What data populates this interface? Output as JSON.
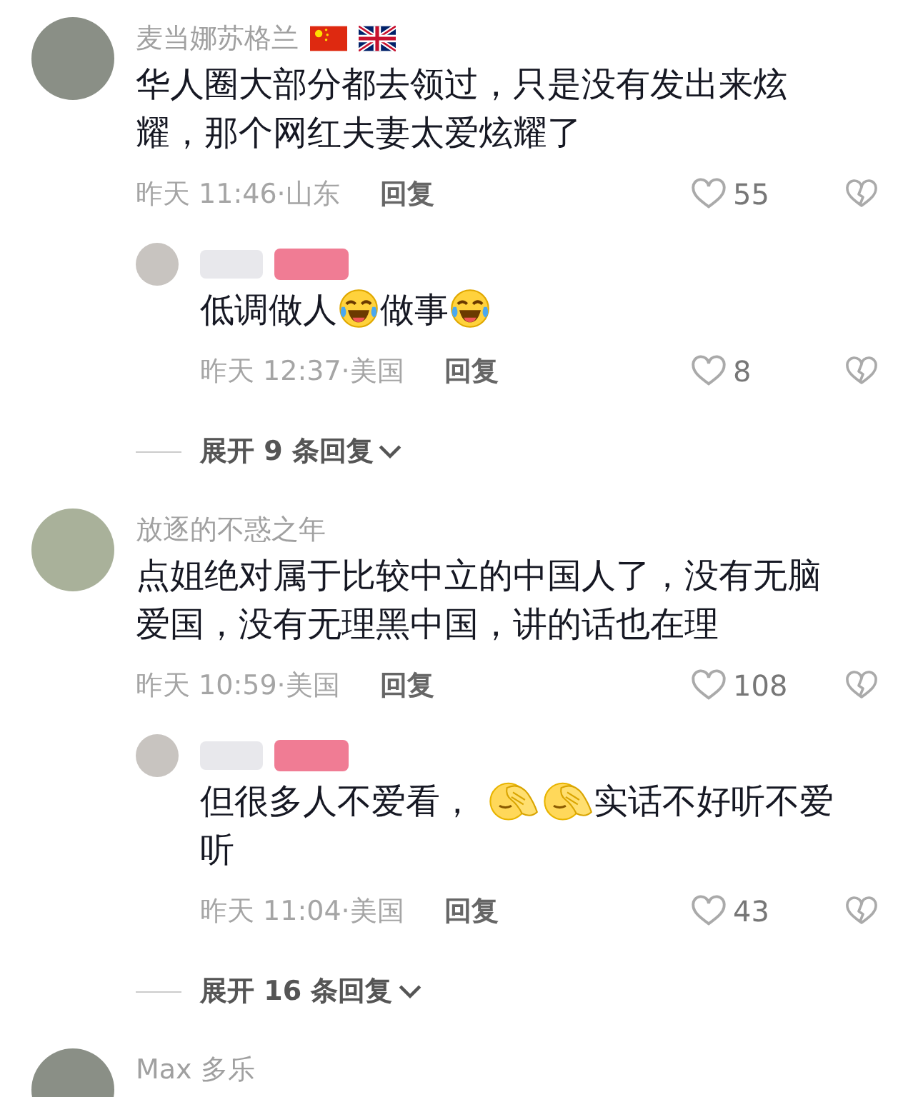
{
  "comments": [
    {
      "author": "麦当娜苏格兰",
      "flags": [
        {
          "kind": "cn"
        },
        {
          "kind": "uk"
        }
      ],
      "text": [
        {
          "kind": "text",
          "text": "华人圈大部分都去领过，只是没有发出来炫耀，那个网红夫妻太爱炫耀了"
        }
      ],
      "time": "昨天 11:46·山东",
      "reply_label": "回复",
      "likes": "55",
      "replies": [
        {
          "text": [
            {
              "kind": "text",
              "text": "低调做人"
            },
            {
              "kind": "laughing_tears"
            },
            {
              "kind": "text",
              "text": "做事"
            },
            {
              "kind": "laughing_tears"
            }
          ],
          "time": "昨天 12:37·美国",
          "reply_label": "回复",
          "likes": "8"
        }
      ],
      "expand_label": "展开 9 条回复"
    },
    {
      "author": "放逐的不惑之年",
      "text": [
        {
          "kind": "text",
          "text": "点姐绝对属于比较中立的中国人了，没有无脑爱国，没有无理黑中国，讲的话也在理"
        }
      ],
      "time": "昨天 10:59·美国",
      "reply_label": "回复",
      "likes": "108",
      "replies": [
        {
          "text": [
            {
              "kind": "text",
              "text": "但很多人不爱看， "
            },
            {
              "kind": "facepalm"
            },
            {
              "kind": "facepalm"
            },
            {
              "kind": "text",
              "text": "实话不好听不爱听"
            }
          ],
          "time": "昨天 11:04·美国",
          "reply_label": "回复",
          "likes": "43"
        }
      ],
      "expand_label": "展开 16 条回复"
    },
    {
      "author": "Max 多乐"
    }
  ]
}
